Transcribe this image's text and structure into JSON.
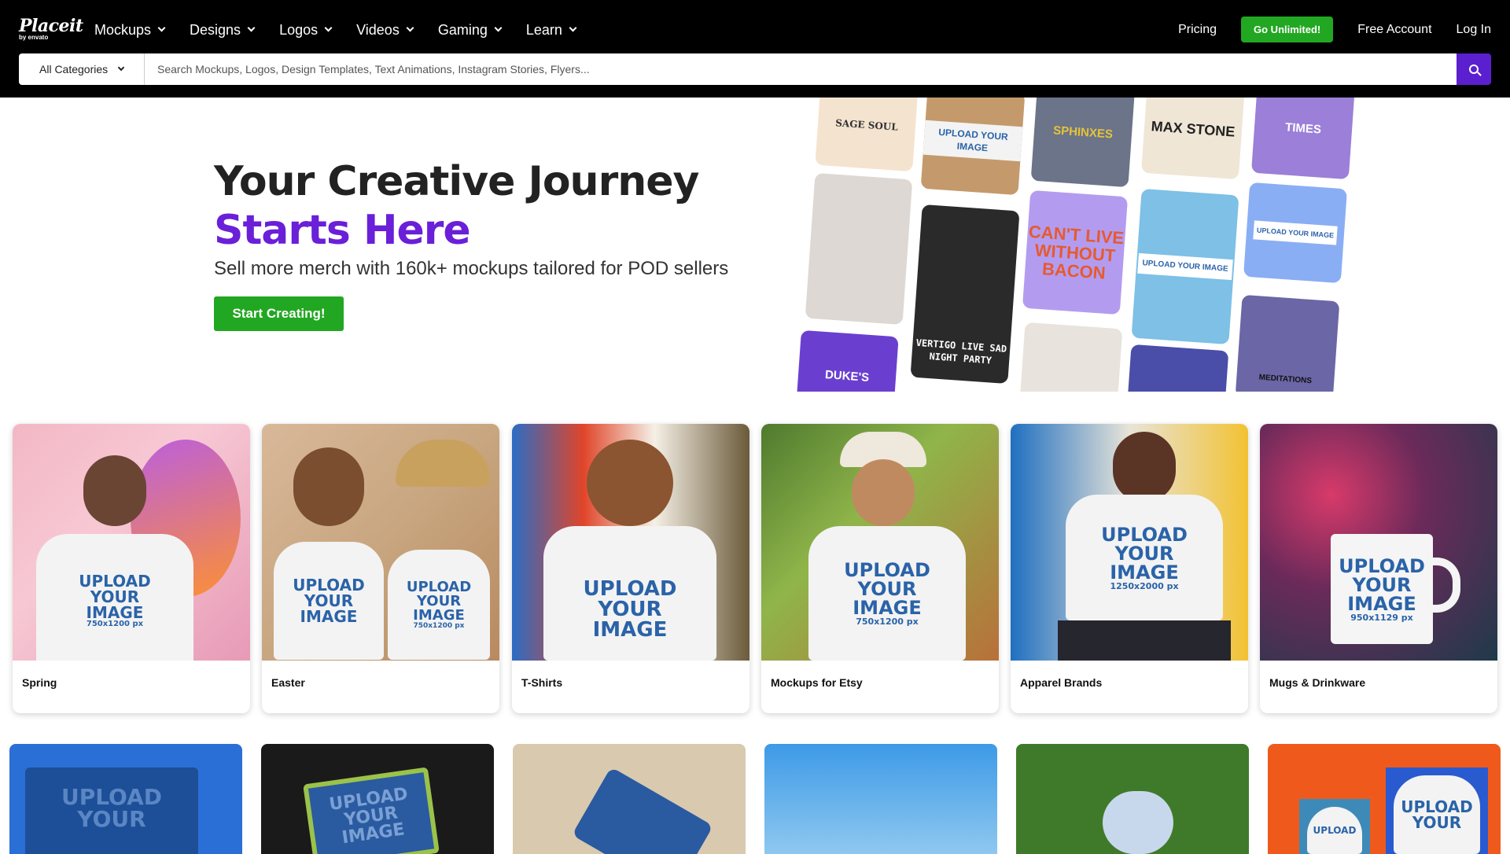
{
  "header": {
    "logo_main": "Placeit",
    "logo_sub": "by envato",
    "nav": [
      "Mockups",
      "Designs",
      "Logos",
      "Videos",
      "Gaming",
      "Learn"
    ],
    "pricing": "Pricing",
    "unlimited": "Go Unlimited!",
    "free_account": "Free Account",
    "login": "Log In"
  },
  "search": {
    "category": "All Categories",
    "placeholder": "Search Mockups, Logos, Design Templates, Text Animations, Instagram Stories, Flyers..."
  },
  "hero": {
    "title_line1": "Your Creative Journey",
    "title_line2": "Starts Here",
    "subtitle": "Sell more merch with 160k+ mockups tailored for POD sellers",
    "cta": "Start Creating!"
  },
  "collage": {
    "tiles": [
      "SAGE SOUL",
      "UPLOAD YOUR IMAGE",
      "SPHINXES",
      "MAX STONE",
      "TIMES",
      "CAN'T LIVE WITHOUT BACON",
      "VERTIGO LIVE SAD NIGHT PARTY",
      "UPLOAD YOUR IMAGE",
      "UPLOAD YOUR IMAGE",
      "DUKE'S",
      "MEDITATIONS"
    ]
  },
  "upload_text": {
    "line1": "UPLOAD",
    "line2": "YOUR",
    "line3": "IMAGE",
    "size_750": "750x1200 px",
    "size_1250": "1250x2000 px",
    "size_950": "950x1129 px"
  },
  "cards": [
    {
      "label": "Spring"
    },
    {
      "label": "Easter"
    },
    {
      "label": "T-Shirts"
    },
    {
      "label": "Mockups for Etsy"
    },
    {
      "label": "Apparel Brands"
    },
    {
      "label": "Mugs & Drinkware"
    }
  ],
  "colors": {
    "accent_purple": "#6a1fd8",
    "green": "#22a722",
    "search_purple": "#5b1fcf"
  }
}
